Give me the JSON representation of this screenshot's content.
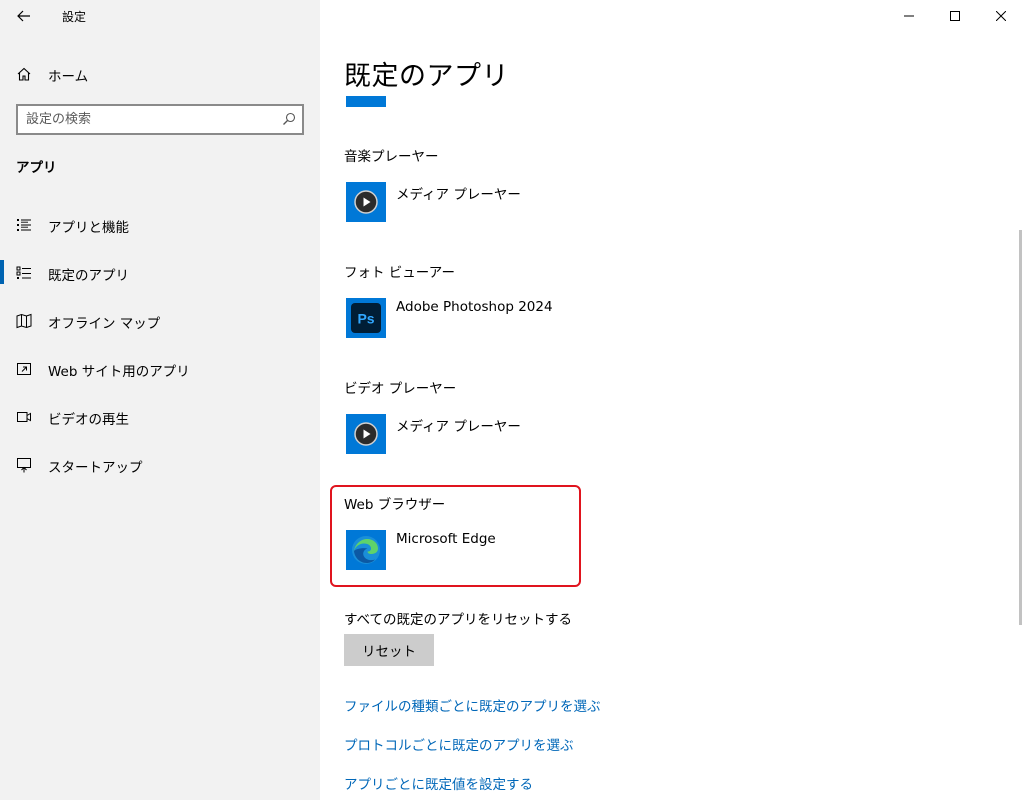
{
  "window": {
    "title": "設定",
    "controls": [
      "minimize",
      "maximize",
      "close"
    ]
  },
  "sidebar": {
    "home_label": "ホーム",
    "search": {
      "placeholder": "設定の検索"
    },
    "section_title": "アプリ",
    "items": [
      {
        "label": "アプリと機能",
        "icon": "apps-features-icon",
        "selected": false
      },
      {
        "label": "既定のアプリ",
        "icon": "default-apps-icon",
        "selected": true
      },
      {
        "label": "オフライン マップ",
        "icon": "offline-maps-icon",
        "selected": false
      },
      {
        "label": "Web サイト用のアプリ",
        "icon": "apps-for-websites-icon",
        "selected": false
      },
      {
        "label": "ビデオの再生",
        "icon": "video-playback-icon",
        "selected": false
      },
      {
        "label": "スタートアップ",
        "icon": "startup-icon",
        "selected": false
      }
    ]
  },
  "main": {
    "title": "既定のアプリ",
    "defaults": [
      {
        "category": "音楽プレーヤー",
        "app": "メディア プレーヤー",
        "icon": "media-player-icon"
      },
      {
        "category": "フォト ビューアー",
        "app": "Adobe Photoshop 2024",
        "icon": "photoshop-icon"
      },
      {
        "category": "ビデオ プレーヤー",
        "app": "メディア プレーヤー",
        "icon": "media-player-icon"
      },
      {
        "category": "Web ブラウザー",
        "app": "Microsoft Edge",
        "icon": "edge-icon"
      }
    ],
    "reset_label": "すべての既定のアプリをリセットする",
    "reset_button": "リセット",
    "links": [
      "ファイルの種類ごとに既定のアプリを選ぶ",
      "プロトコルごとに既定のアプリを選ぶ",
      "アプリごとに既定値を設定する"
    ]
  },
  "colors": {
    "accent": "#0078d7",
    "link": "#0067b8",
    "highlight": "#e0141e",
    "sidebar_bg": "#f2f2f2"
  }
}
